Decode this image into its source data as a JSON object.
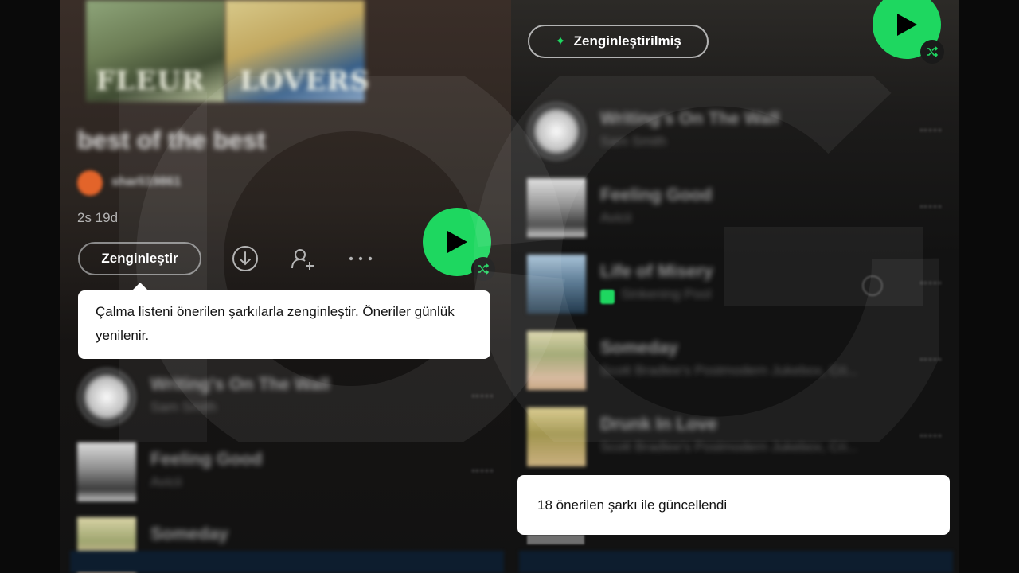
{
  "left_panel": {
    "covers": [
      {
        "caption": "FLEUR"
      },
      {
        "caption": "LOVERS"
      }
    ],
    "playlist_title": "best of the best",
    "owner": "sharli19861",
    "duration": "2s 19d",
    "enhance_button": "Zenginleştir",
    "tooltip": "Çalma listeni önerilen şarkılarla zenginleştir. Öneriler günlük yenilenir.",
    "tracks": [
      {
        "title": "Writing's On The Wall",
        "artist": "Sam Smith"
      },
      {
        "title": "Feeling Good",
        "artist": "Avicii"
      },
      {
        "title": "Someday",
        "artist": ""
      }
    ]
  },
  "right_panel": {
    "enhanced_button": "Zenginleştirilmiş",
    "tracks": [
      {
        "title": "Writing's On The Wall",
        "artist": "Sam Smith"
      },
      {
        "title": "Feeling Good",
        "artist": "Avicii"
      },
      {
        "title": "Life of Misery",
        "artist": "Sinkening Pool"
      },
      {
        "title": "Someday",
        "artist": "Scott Bradlee's Postmodern Jukebox, Cri..."
      },
      {
        "title": "Drunk In Love",
        "artist": "Scott Bradlee's Postmodern Jukebox, Cri..."
      }
    ],
    "toast": "18 önerilen şarkı ile güncellendi"
  },
  "colors": {
    "accent": "#1ed760",
    "background": "#121212",
    "tooltip_bg": "#ffffff"
  },
  "icons": {
    "download": "download-icon",
    "add_user": "add-user-icon",
    "more": "more-icon",
    "play": "play-icon",
    "shuffle": "shuffle-icon",
    "sparkle": "sparkle-icon"
  }
}
